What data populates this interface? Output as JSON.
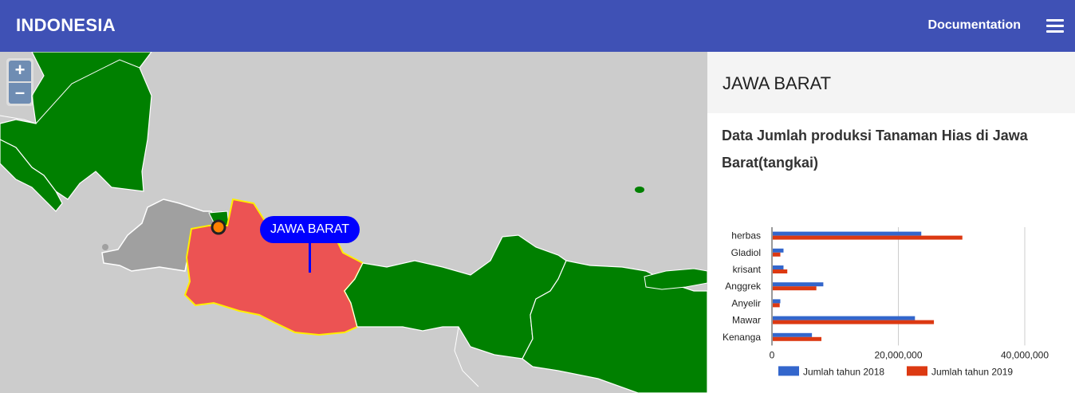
{
  "appbar": {
    "title": "INDONESIA",
    "documentation_label": "Documentation",
    "menu_icon": "hamburger-menu-icon",
    "background": "#3f51b5"
  },
  "map": {
    "zoom_in_label": "+",
    "zoom_out_label": "–",
    "callout_label": "JAWA BARAT",
    "colors": {
      "ocean": "#cccccc",
      "province": "#008000",
      "selected": "#ec5353",
      "selected_border": "#ffee00",
      "neighbor": "#a0a0a0",
      "marker": "#ff7f00"
    }
  },
  "panel": {
    "title": "JAWA BARAT",
    "subtitle": "Data Jumlah produksi Tanaman Hias di Jawa Barat(tangkai)"
  },
  "chart_data": {
    "type": "bar",
    "orientation": "horizontal",
    "categories": [
      "herbas",
      "Gladiol",
      "krisant",
      "Anggrek",
      "Anyelir",
      "Mawar",
      "Kenanga"
    ],
    "series": [
      {
        "name": "Jumlah tahun 2018",
        "color": "#3366cc",
        "values": [
          23500000,
          1700000,
          1700000,
          8000000,
          1200000,
          22500000,
          6200000
        ]
      },
      {
        "name": "Jumlah tahun 2019",
        "color": "#dc3912",
        "values": [
          30000000,
          1200000,
          2300000,
          6900000,
          1100000,
          25500000,
          7700000
        ]
      }
    ],
    "xlim": [
      0,
      40000000
    ],
    "xticks": [
      "0",
      "20,000,000",
      "40,000,000"
    ],
    "grid": true,
    "legend_position": "bottom"
  }
}
